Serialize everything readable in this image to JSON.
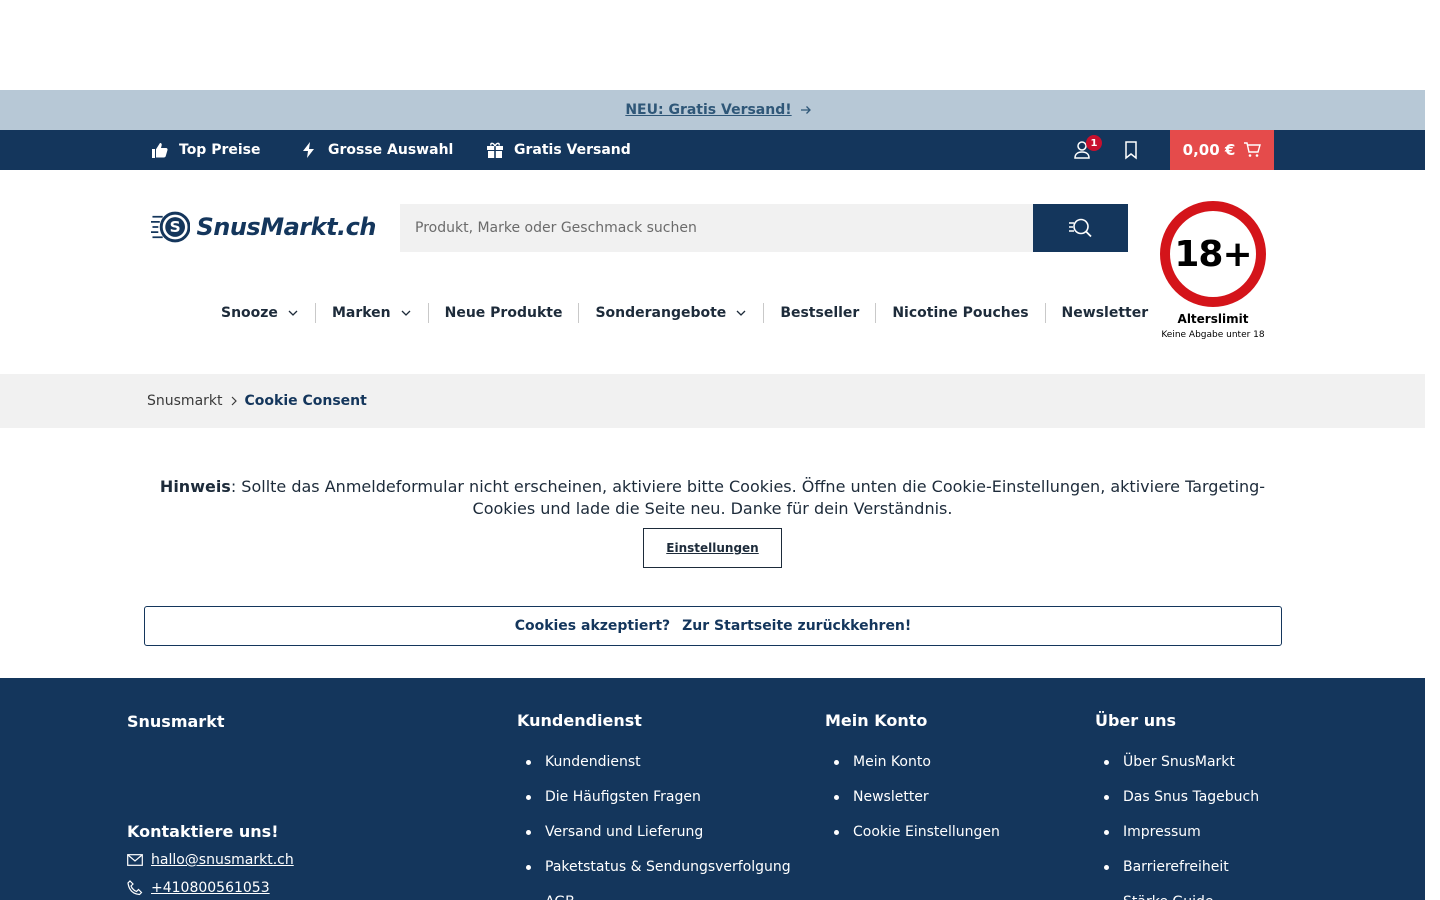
{
  "promo": {
    "text": "NEU: Gratis Versand!",
    "arrow_icon": "arrow-right-icon"
  },
  "usp": {
    "items": [
      {
        "label": "Top Preise",
        "icon": "thumbs-up-icon"
      },
      {
        "label": "Grosse Auswahl",
        "icon": "lightning-icon"
      },
      {
        "label": "Gratis Versand",
        "icon": "gift-icon"
      }
    ],
    "account_badge": "1",
    "cart_total": "0,00 €"
  },
  "header": {
    "logo_text": "SnusMarkt.ch",
    "search_placeholder": "Produkt, Marke oder Geschmack suchen",
    "age_badge": {
      "number": "18+",
      "title": "Alterslimit",
      "subtitle": "Keine Abgabe unter 18"
    }
  },
  "nav": {
    "items": [
      {
        "label": "Snooze",
        "dropdown": true
      },
      {
        "label": "Marken",
        "dropdown": true
      },
      {
        "label": "Neue Produkte",
        "dropdown": false
      },
      {
        "label": "Sonderangebote",
        "dropdown": true
      },
      {
        "label": "Bestseller",
        "dropdown": false
      },
      {
        "label": "Nicotine Pouches",
        "dropdown": false
      },
      {
        "label": "Newsletter",
        "dropdown": false
      }
    ]
  },
  "breadcrumb": {
    "home": "Snusmarkt",
    "current": "Cookie Consent"
  },
  "content": {
    "notice_label": "Hinweis",
    "notice_text": ": Sollte das Anmeldeformular nicht erscheinen, aktiviere bitte Cookies. Öffne unten die Cookie-Einstellungen, aktiviere Targeting-Cookies und lade die Seite neu. Danke für dein Verständnis.",
    "settings_button": "Einstellungen",
    "accepted_text": "Cookies akzeptiert?",
    "accepted_link": "Zur Startseite zurückkehren!"
  },
  "footer": {
    "brand": "Snusmarkt",
    "contact_heading": "Kontaktiere uns!",
    "email": "hallo@snusmarkt.ch",
    "phone": "+410800561053",
    "columns": [
      {
        "title": "Kundendienst",
        "links": [
          "Kundendienst",
          "Die Häufigsten Fragen",
          "Versand und Lieferung",
          "Paketstatus & Sendungsverfolgung",
          "AGB"
        ]
      },
      {
        "title": "Mein Konto",
        "links": [
          "Mein Konto",
          "Newsletter",
          "Cookie Einstellungen"
        ]
      },
      {
        "title": "Über uns",
        "links": [
          "Über SnusMarkt",
          "Das Snus Tagebuch",
          "Impressum",
          "Barrierefreiheit",
          "Stärke Guide"
        ]
      }
    ]
  },
  "colors": {
    "navy": "#14365c",
    "promo_bg": "#b7c8d6",
    "cart_red": "#e54b4b",
    "age_red": "#d4141a",
    "badge_red": "#c8102e"
  }
}
